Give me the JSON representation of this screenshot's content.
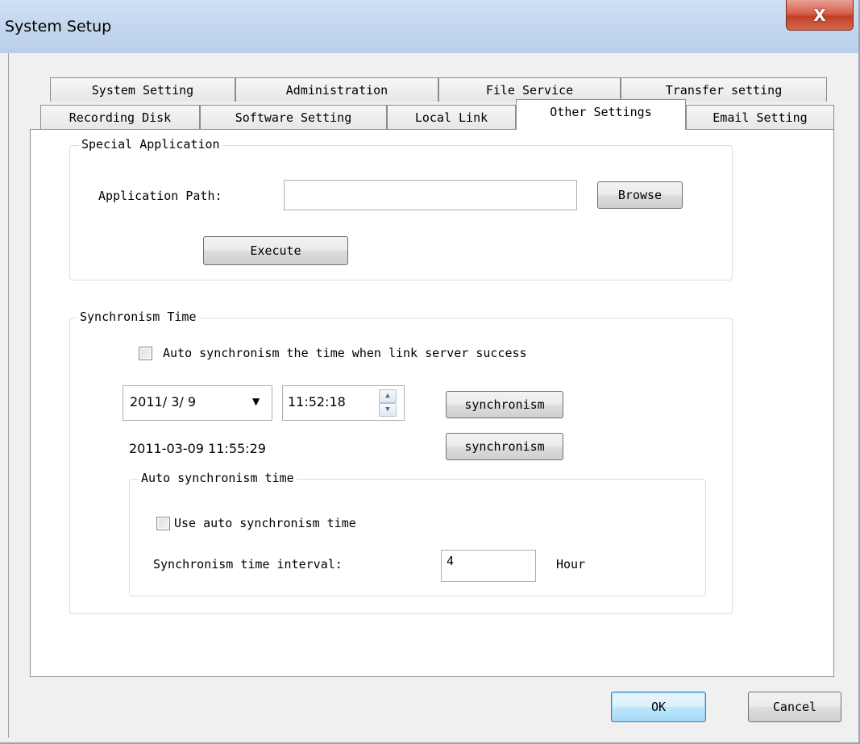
{
  "window": {
    "title": "System Setup",
    "close_glyph": "X"
  },
  "tabs": {
    "row1": [
      "System Setting",
      "Administration",
      "File Service",
      "Transfer setting"
    ],
    "row2": [
      "Recording Disk",
      "Software Setting",
      "Local Link",
      "Other Settings",
      "Email Setting"
    ],
    "active": "Other Settings"
  },
  "special_application": {
    "caption": "Special Application",
    "path_label": "Application Path:",
    "path_value": "",
    "browse_label": "Browse",
    "execute_label": "Execute"
  },
  "sync_time": {
    "caption": "Synchronism Time",
    "auto_link_label": "Auto synchronism the time when link server success",
    "auto_link_checked": false,
    "date_value": "2011/ 3/ 9",
    "time_value": "11:52:18",
    "sync_button_1": "synchronism",
    "server_datetime": "2011-03-09 11:55:29",
    "sync_button_2": "synchronism",
    "auto_group": {
      "caption": "Auto synchronism time",
      "use_auto_label": "Use auto synchronism time",
      "use_auto_checked": false,
      "interval_label": "Synchronism time interval:",
      "interval_value": "4",
      "interval_unit": "Hour"
    }
  },
  "footer": {
    "ok_label": "OK",
    "cancel_label": "Cancel"
  },
  "icons": {
    "close": "close-icon",
    "dropdown": "chevron-down-icon",
    "spin_up": "arrow-up-icon",
    "spin_down": "arrow-down-icon"
  }
}
